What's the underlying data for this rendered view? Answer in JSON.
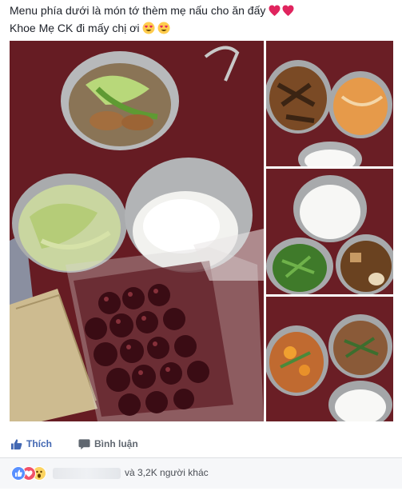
{
  "post": {
    "line1": "Menu phía dưới là món tớ thèm mẹ nấu cho ăn đấy",
    "line2": "Khoe Mẹ CK đi mấy chị ơi"
  },
  "actions": {
    "like_label": "Thích",
    "comment_label": "Bình luận"
  },
  "reactions": {
    "summary": "và 3,2K người khác"
  },
  "colors": {
    "brand_blue": "#4267b2",
    "action_gray": "#606770",
    "heart": "#e0245e",
    "tablecloth": "#6e1f26"
  },
  "icons": [
    "heart-emoji",
    "heart-eyes-emoji",
    "like-icon",
    "comment-icon",
    "like-reaction-icon",
    "love-reaction-icon",
    "wow-reaction-icon"
  ]
}
